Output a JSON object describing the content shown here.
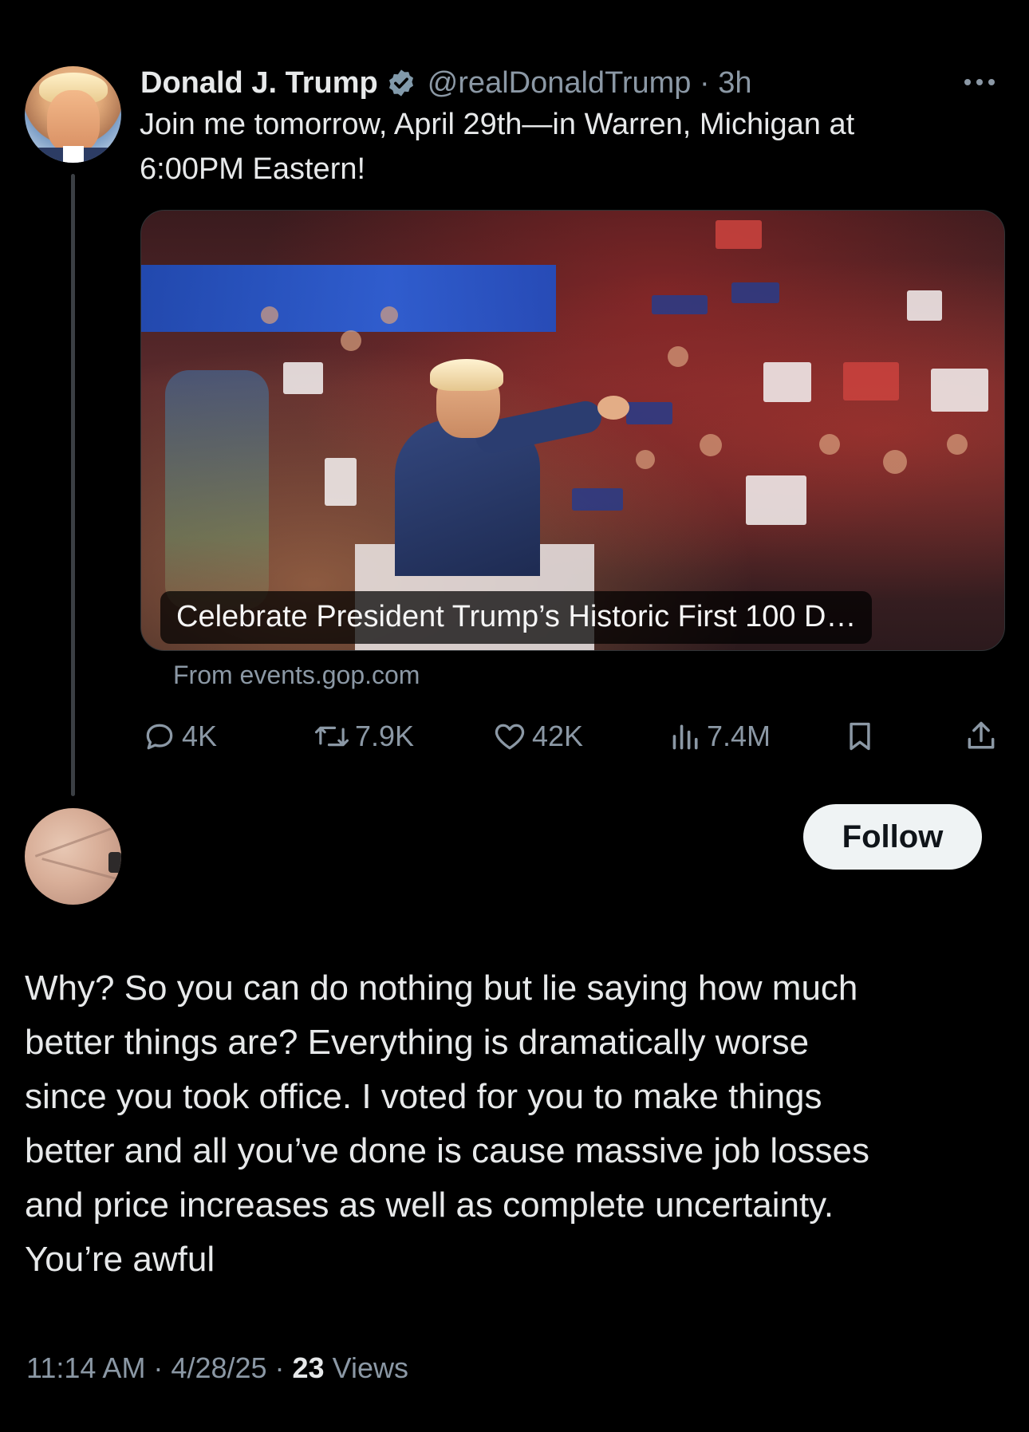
{
  "original_tweet": {
    "author_name": "Donald J. Trump",
    "handle_and_time": "@realDonaldTrump · 3h",
    "verified": true,
    "text": "Join me tomorrow, April 29th—in Warren, Michigan at\n6:00PM Eastern!",
    "card": {
      "caption": "Celebrate President Trump’s Historic First 100 D…",
      "source": "From events.gop.com"
    },
    "actions": {
      "replies": "4K",
      "reposts": "7.9K",
      "likes": "42K",
      "views": "7.4M"
    },
    "icons": {
      "more": "more-horizontal-icon",
      "reply": "reply-bubble-icon",
      "repost": "repost-icon",
      "like": "heart-icon",
      "views": "bar-chart-icon",
      "bookmark": "bookmark-icon",
      "share": "share-icon",
      "verified": "verified-badge-icon"
    },
    "colors": {
      "verified_badge": "#829aab",
      "muted_text": "#8b98a5"
    }
  },
  "reply": {
    "follow_label": "Follow",
    "text": "Why? So you can do nothing but lie saying how much\nbetter things are? Everything is dramatically worse\nsince you took office. I voted for you to make things\nbetter and all you’ve done is cause massive job losses\nand price increases as well as complete uncertainty.\nYou’re awful",
    "time_date": "11:14 AM · 4/28/25 · ",
    "views_count": "23",
    "views_label": " Views"
  }
}
